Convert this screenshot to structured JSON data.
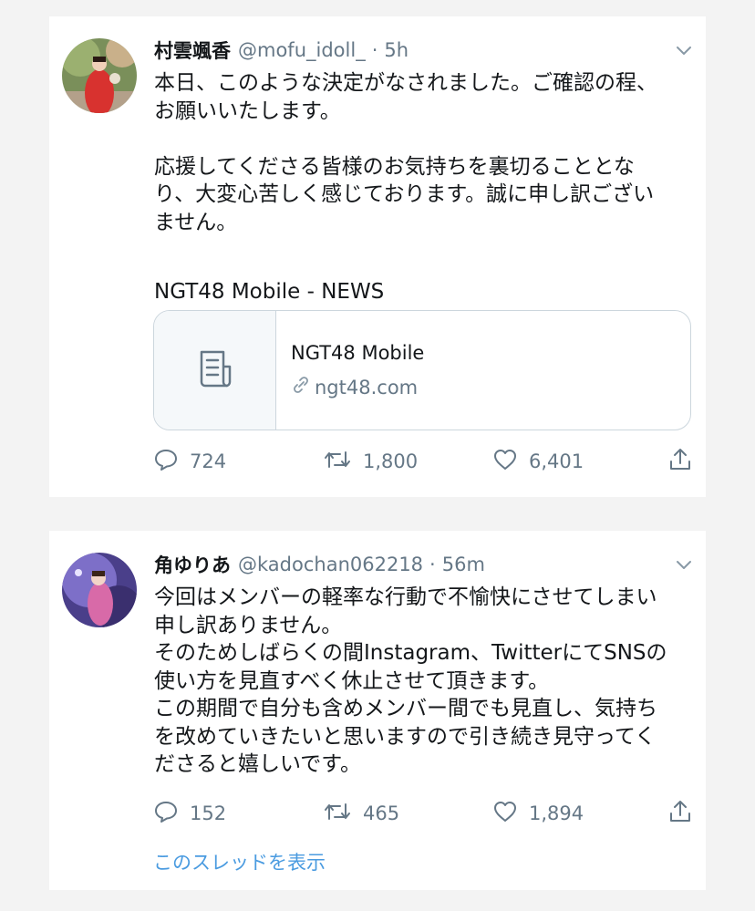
{
  "tweets": [
    {
      "name": "村雲颯香",
      "handle": "@mofu_idoll_",
      "separator": "·",
      "time": "5h",
      "lines": [
        "本日、このような決定がなされました。ご確認の程、",
        "お願いいたします。",
        "",
        "応援してくださる皆様のお気持ちを裏切ることとな",
        "り、大変心苦しく感じております。誠に申し訳ござい",
        "ません。",
        "",
        "NGT48 Mobile - NEWS"
      ],
      "link_card": {
        "title": "NGT48 Mobile",
        "domain": "ngt48.com",
        "thumb_icon": "document-icon"
      },
      "stats": {
        "replies": "724",
        "retweets": "1,800",
        "likes": "6,401"
      }
    },
    {
      "name": "角ゆりあ",
      "handle": "@kadochan062218",
      "separator": "·",
      "time": "56m",
      "lines": [
        "今回はメンバーの軽率な行動で不愉快にさせてしまい",
        "申し訳ありません。",
        "そのためしばらくの間Instagram、TwitterにてSNSの",
        "使い方を見直すべく休止させて頂きます。",
        "この期間で自分も含めメンバー間でも見直し、気持ち",
        "を改めていきたいと思いますので引き続き見守ってく",
        "ださると嬉しいです。"
      ],
      "stats": {
        "replies": "152",
        "retweets": "465",
        "likes": "1,894"
      },
      "thread_link": "このスレッドを表示"
    }
  ],
  "icons": [
    "reply-icon",
    "retweet-icon",
    "like-icon",
    "share-icon",
    "chevron-down-icon",
    "link-icon"
  ],
  "colors": {
    "link": "#4a9be0",
    "muted": "#657786",
    "border": "#ccd6dd",
    "text": "#14171a"
  }
}
